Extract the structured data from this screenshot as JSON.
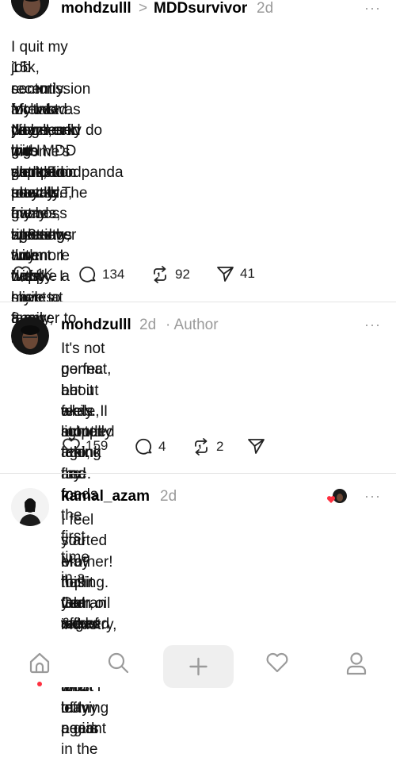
{
  "post1": {
    "username": "mohdzulll",
    "separator": ">",
    "community": "MDDsurvivor",
    "time": "2d",
    "more": "···",
    "lines": [
      "I quit my job recently. My last paycheck was almost",
      "15k, commission included. I'd been in the plantation",
      "sector for two years, but I decided to walk away right",
      "after I was diagnosed with MDD and panic attacks.",
      "Now I only do gig work,Foodpanda mostly. The",
      "income's super unstable, but honestly, I'm happy. I",
      "get to see my friends, spend time with my family, and",
      "play games whenever I want. I don't have to answer to",
      "my boss at 3 am. anymore or fake a smile at 8 am",
      "meetings with fussy clients."
    ],
    "likes": "1K",
    "comments": "134",
    "reposts": "92",
    "shares": "41"
  },
  "reply1": {
    "username": "mohdzulll",
    "time": "2d",
    "tag": "· Author",
    "more": "···",
    "lines": [
      "It's not perfect, but it feels lighter. I think I'm",
      "gonna be okay. I stopped taking my meds",
      "about a month ago, and for the first time in a",
      "while, I actually feel free."
    ],
    "likes": "159",
    "comments": "4",
    "reposts": "2"
  },
  "reply2": {
    "username": "kamal_azam",
    "time": "2d",
    "more": "···",
    "lines": [
      "I feel you brother! I quit from oil & gas and",
      "started e-hailing. Got an offer from Petronas in",
      "May this year, worked for a week and left again",
      "for the sake of my sanity. Most of my peers",
      "told me of such a loss for leaving a giant in the",
      "industry, but I know what I truly need."
    ]
  },
  "nav": {
    "items": [
      "home-icon",
      "search-icon",
      "plus-icon",
      "heart-icon",
      "profile-icon"
    ],
    "active": "home",
    "accent": "#ff3040"
  }
}
